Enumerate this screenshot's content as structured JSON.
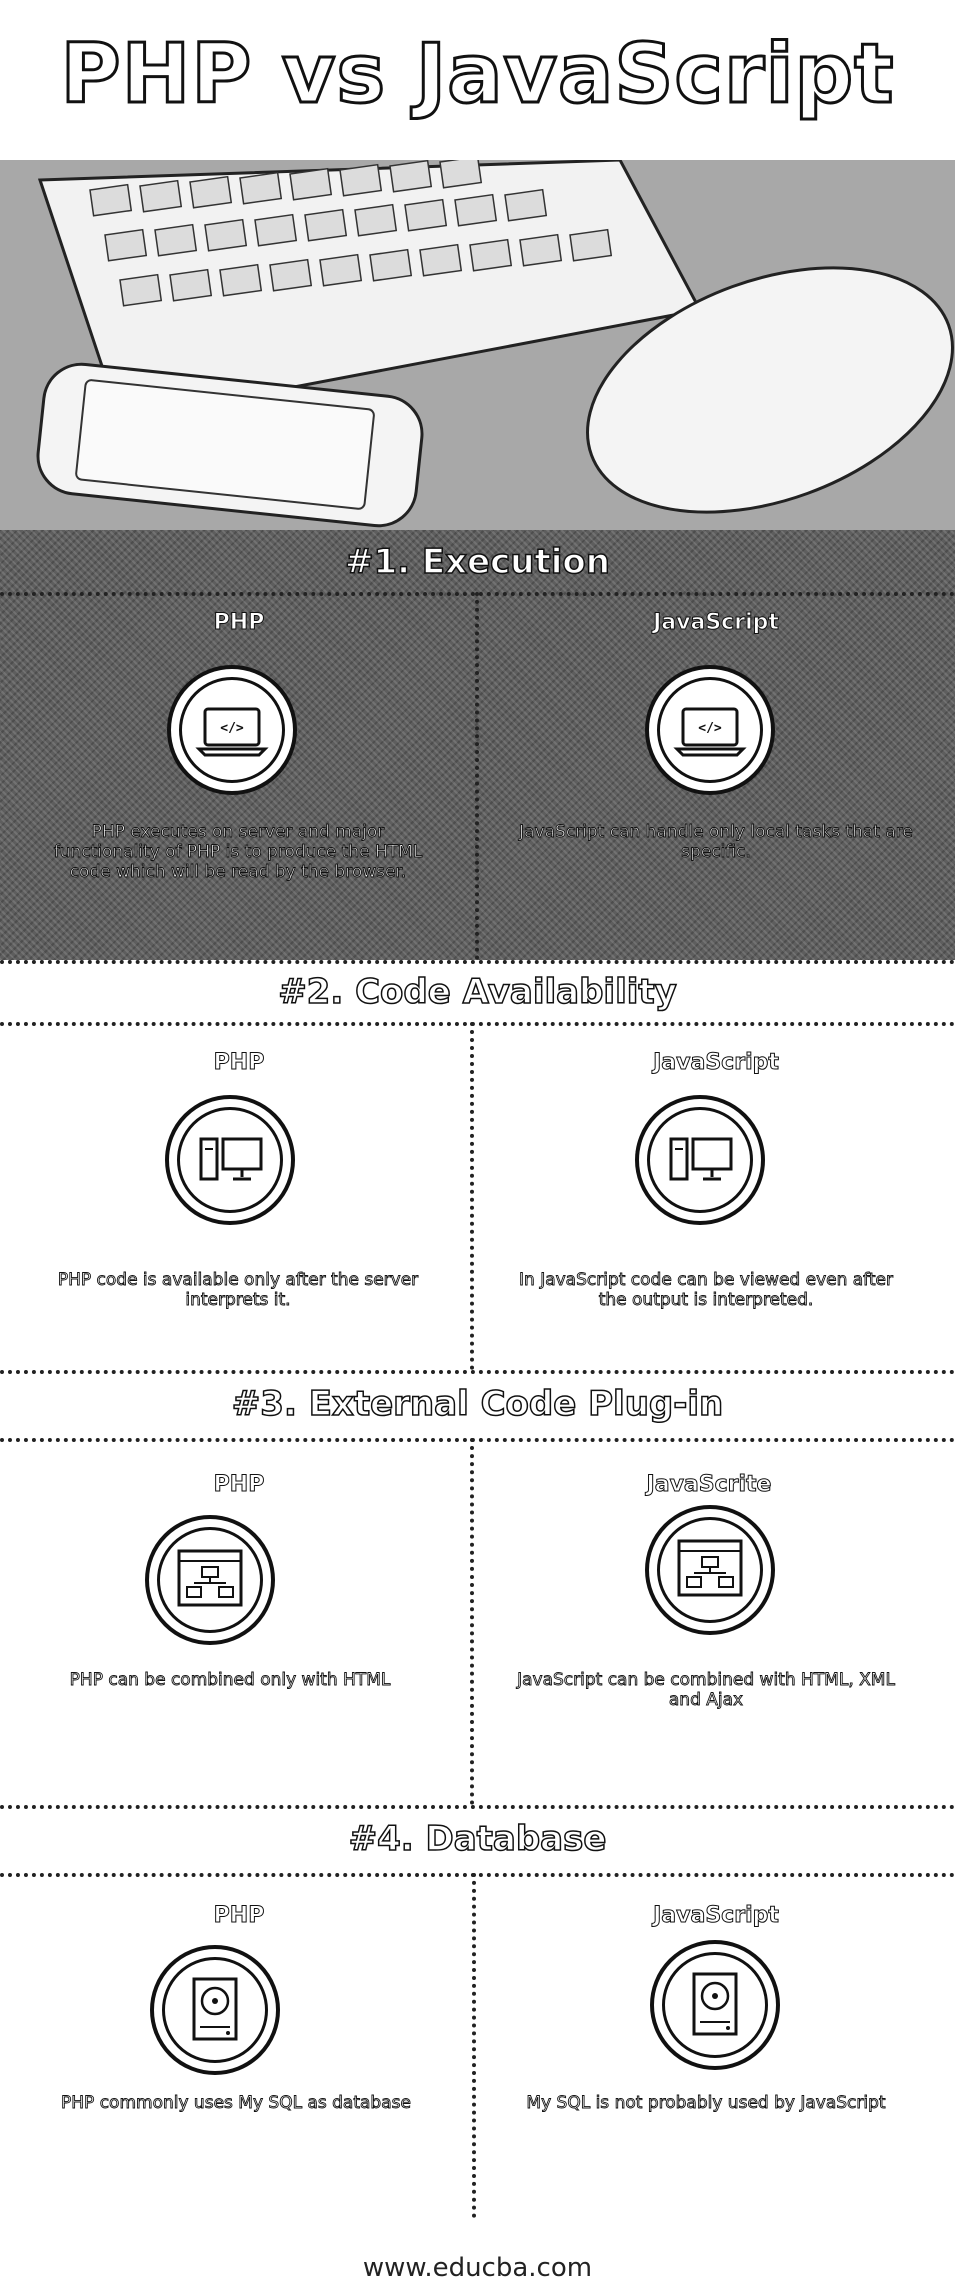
{
  "title": "PHP vs JavaScript",
  "sections": [
    {
      "title": "#1. Execution",
      "left": {
        "head": "PHP",
        "icon": "code-laptop-icon",
        "text": "PHP executes on server and major functionality of PHP is to produce the HTML code which will be read by the browser."
      },
      "right": {
        "head": "JavaScript",
        "icon": "code-laptop-icon",
        "text": "JavaScript can handle only local tasks that are specific."
      }
    },
    {
      "title": "#2. Code Availability",
      "left": {
        "head": "PHP",
        "icon": "desktop-computer-icon",
        "text": "PHP code is available only after the server interprets it."
      },
      "right": {
        "head": "JavaScript",
        "icon": "desktop-computer-icon",
        "text": "In JavaScript code can be viewed even after the output is interpreted."
      }
    },
    {
      "title": "#3. External Code Plug-in",
      "left": {
        "head": "PHP",
        "icon": "browser-sitemap-icon",
        "text": "PHP can be combined only with HTML"
      },
      "right": {
        "head": "JavaScrite",
        "icon": "browser-sitemap-icon",
        "text": "JavaScript can be combined with HTML, XML and Ajax"
      }
    },
    {
      "title": "#4. Database",
      "left": {
        "head": "PHP",
        "icon": "hard-drive-icon",
        "text": "PHP commonly uses My SQL as database"
      },
      "right": {
        "head": "JavaScript",
        "icon": "hard-drive-icon",
        "text": "My SQL is not probably used by JavaScript"
      }
    }
  ],
  "footer": "www.educba.com"
}
